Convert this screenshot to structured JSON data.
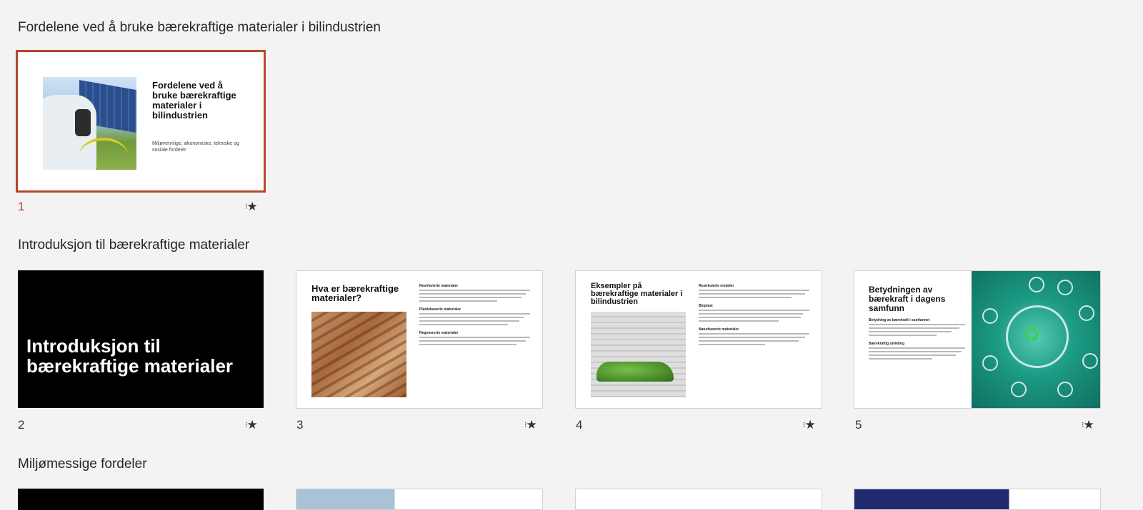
{
  "sections": [
    {
      "title": "Fordelene ved å bruke bærekraftige materialer i bilindustrien"
    },
    {
      "title": "Introduksjon til bærekraftige materialer"
    },
    {
      "title": "Miljømessige fordeler"
    }
  ],
  "slides": [
    {
      "number": "1",
      "title": "Fordelene ved å bruke bærekraftige materialer i bilindustrien",
      "subtitle": "Miljøvennlige, økonomiske, tekniske og sosiale fordeler",
      "selected": true
    },
    {
      "number": "2",
      "title": "Introduksjon til bærekraftige materialer"
    },
    {
      "number": "3",
      "title": "Hva er bærekraftige materialer?",
      "headings": [
        "Resirkulerte materialer",
        "Plantebaserte materialer",
        "Regenererte materialer"
      ]
    },
    {
      "number": "4",
      "title": "Eksempler på bærekraftige materialer i bilindustrien",
      "headings": [
        "Resirkulerte metaller",
        "Bioplast",
        "Naturbaserte materialer"
      ]
    },
    {
      "number": "5",
      "title": "Betydningen av bærekraft i dagens samfunn",
      "headings": [
        "Betydning av bærekraft i samfunnet",
        "Bærekraftig utvikling"
      ]
    }
  ],
  "transition_icon": "animation-star-icon",
  "colors": {
    "background": "#f3f3f3",
    "selection": "#b7472a"
  }
}
